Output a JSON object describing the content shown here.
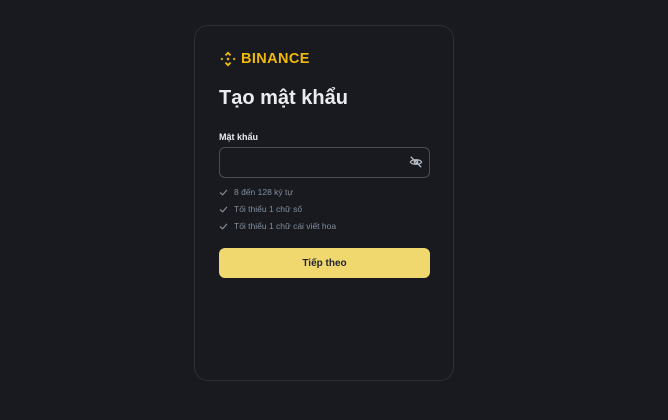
{
  "brand": {
    "name": "BINANCE",
    "logo_icon": "binance-diamond-logo",
    "color": "#f0b90b"
  },
  "page": {
    "title": "Tạo mật khẩu"
  },
  "password_field": {
    "label": "Mật khẩu",
    "value": "",
    "placeholder": "",
    "toggle_icon": "eye-off-icon"
  },
  "requirements": [
    {
      "text": "8 đến 128 ký tự",
      "icon": "check-icon"
    },
    {
      "text": "Tối thiểu 1 chữ số",
      "icon": "check-icon"
    },
    {
      "text": "Tối thiểu 1 chữ cái viết hoa",
      "icon": "check-icon"
    }
  ],
  "actions": {
    "next_label": "Tiếp theo"
  },
  "colors": {
    "background": "#181a20",
    "card_border": "#2b2f36",
    "primary_button": "#f0d86e",
    "text_primary": "#eaecef",
    "text_muted": "#848e9c"
  }
}
